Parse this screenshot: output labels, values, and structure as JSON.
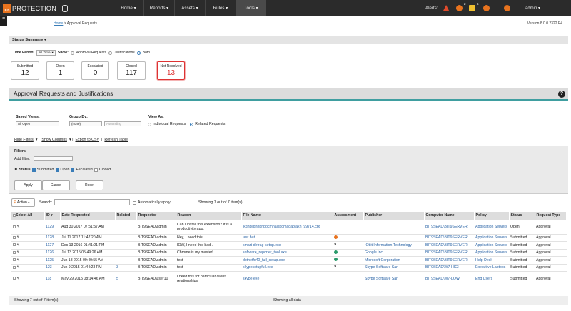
{
  "brand": {
    "name": "PROTECTION",
    "mark": "Cb"
  },
  "nav": [
    "Home",
    "Reports",
    "Assets",
    "Rules",
    "Tools"
  ],
  "alerts": {
    "label": "Alerts:",
    "badges": [
      "3",
      "2",
      "6"
    ]
  },
  "user": "admin",
  "breadcrumb": {
    "home": "Home",
    "current": "Approval Requests"
  },
  "version": "Version 8.0.0.2322 P4",
  "summary": {
    "title": "Status Summary",
    "time_label": "Time Period:",
    "time_value": "All Time",
    "show_label": "Show:",
    "show_options": [
      "Approval Requests",
      "Justifications",
      "Both"
    ],
    "cards": [
      {
        "label": "Submitted",
        "value": "12"
      },
      {
        "label": "Open",
        "value": "1"
      },
      {
        "label": "Escalated",
        "value": "0"
      },
      {
        "label": "Closed",
        "value": "117"
      },
      {
        "label": "Not Resolved",
        "value": "13"
      }
    ]
  },
  "section_title": "Approval Requests and Justifications",
  "saved_views": {
    "label": "Saved Views:",
    "value": "All Open"
  },
  "group_by": {
    "label": "Group By:",
    "value": "(none)",
    "order": "Ascending"
  },
  "view_as": {
    "label": "View As:",
    "options": [
      "Individual Requests",
      "Related Requests"
    ]
  },
  "links": [
    "Hide Filters",
    "Show Columns",
    "Export to CSV",
    "Refresh Table"
  ],
  "filters": {
    "title": "Filters",
    "add_label": "Add filter:",
    "status_label": "Status",
    "statuses": [
      "Submitted",
      "Open",
      "Escalated",
      "Closed"
    ],
    "buttons": [
      "Apply",
      "Cancel",
      "Reset"
    ]
  },
  "actions": {
    "action": "Action",
    "search_label": "Search:",
    "auto_apply": "Automatically apply",
    "showing": "Showing 7 out of 7 item(s)"
  },
  "table": {
    "headers": [
      "Select All",
      "ID",
      "Date Requested",
      "Related",
      "Requestor",
      "Reason",
      "File Name",
      "Assessment",
      "Publisher",
      "Computer Name",
      "Policy",
      "Status",
      "Request Type"
    ],
    "rows": [
      {
        "id": "1129",
        "date": "Aug 30 2017 07:51:57 AM",
        "related": "",
        "req": "BIT9SEAD\\admin",
        "reason": "Can I install this extension? It is a",
        "reason2": "productivity app.",
        "file": "jkdhpilghnbhbpcmnajkpdmadaolakh_99714.crx",
        "assess": "",
        "pub": "",
        "comp": "BIT9SEAD\\BIT9SERVER",
        "policy": "Application Servers",
        "status": "Open",
        "type": "Approval"
      },
      {
        "id": "1128",
        "date": "Jul 11 2017 11:47:20 AM",
        "related": "",
        "req": "BIT9SEAD\\admin",
        "reason": "Hey, I need this.",
        "reason2": "",
        "file": "test.bat",
        "assess": "warn",
        "pub": "",
        "comp": "BIT9SEAD\\BIT9SERVER",
        "policy": "Application Servers",
        "status": "Submitted",
        "type": "Approval"
      },
      {
        "id": "1127",
        "date": "Dec 13 2016 01:41:21 PM",
        "related": "",
        "req": "BIT9SEAD\\admin",
        "reason": "IOW, I need this bad...",
        "reason2": "",
        "file": "smart-defrag-setup.exe",
        "assess": "?",
        "pub": "IObit Information Technology",
        "comp": "BIT9SEAD\\BIT9SERVER",
        "policy": "Application Servers",
        "status": "Submitted",
        "type": "Approval"
      },
      {
        "id": "1126",
        "date": "Jul 13 2015 05:49:26 AM",
        "related": "",
        "req": "BIT9SEAD\\admin",
        "reason": "Chrome is my master!",
        "reason2": "",
        "file": "software_reporter_tool.exe",
        "assess": "ok",
        "pub": "Google Inc",
        "comp": "BIT9SEAD\\BIT9SERVER",
        "policy": "Application Servers",
        "status": "Submitted",
        "type": "Approval"
      },
      {
        "id": "1125",
        "date": "Jun 18 2015 09:49:55 AM",
        "related": "",
        "req": "BIT9SEAD\\admin",
        "reason": "test",
        "reason2": "",
        "file": "dotnetfx40_full_setup.exe",
        "assess": "ok",
        "pub": "Microsoft Corporation",
        "comp": "BIT9SEAD\\BIT9SERVER",
        "policy": "Help Desk",
        "status": "Submitted",
        "type": "Approval"
      },
      {
        "id": "123",
        "date": "Jun 9 2015 01:44:23 PM",
        "related": "3",
        "req": "BIT9SEAD\\admin",
        "reason": "test",
        "reason2": "",
        "file": "skypesetupfull.exe",
        "assess": "?",
        "pub": "Skype Software Sarl",
        "comp": "BIT9SEAD\\W7-HIGH",
        "policy": "Executive Laptops",
        "status": "Submitted",
        "type": "Approval"
      },
      {
        "id": "118",
        "date": "May 29 2015 08:14:46 AM",
        "related": "5",
        "req": "BIT9SEAD\\user10",
        "reason": "I need this for particular client",
        "reason2": "relationships",
        "file": "skype.exe",
        "assess": "",
        "pub": "Skype Software Sarl",
        "comp": "BIT9SEAD\\W7-LOW",
        "policy": "End Users",
        "status": "Submitted",
        "type": "Approval"
      }
    ]
  },
  "footer": {
    "left": "Showing 7 out of 7 item(s)",
    "center": "Showing all data"
  },
  "colors": {
    "accent": "#3f9ea0",
    "orange": "#e8731e",
    "link": "#2a64a6"
  }
}
